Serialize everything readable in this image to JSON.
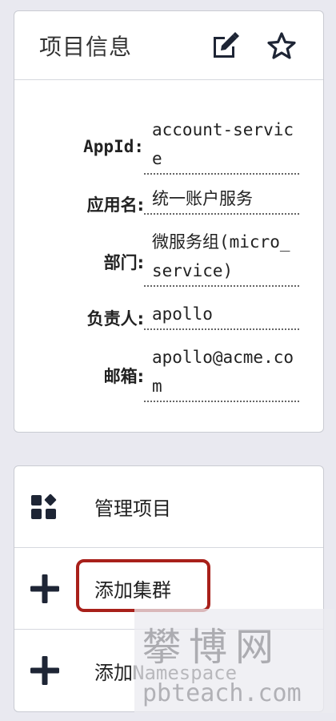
{
  "info": {
    "title": "项目信息",
    "icons": {
      "edit": "edit-icon",
      "favorite": "star-icon"
    },
    "fields": [
      {
        "label": "AppId:",
        "value": "account-service"
      },
      {
        "label": "应用名:",
        "value": "统一账户服务"
      },
      {
        "label": "部门:",
        "value": "微服务组(micro_service)"
      },
      {
        "label": "负责人:",
        "value": "apollo"
      },
      {
        "label": "邮箱:",
        "value": "apollo@acme.com"
      }
    ]
  },
  "actions": [
    {
      "label": "管理项目",
      "icon": "manage-grid-icon"
    },
    {
      "label": "添加集群",
      "icon": "plus-icon"
    },
    {
      "label_prefix": "添加",
      "label_ns": "Namespace",
      "icon": "plus-icon"
    }
  ],
  "watermark": {
    "cn": "攀博网",
    "en": "pbteach.com"
  },
  "colors": {
    "highlight": "#a8201a",
    "icon": "#1e2535",
    "background": "#e9e9f0"
  }
}
